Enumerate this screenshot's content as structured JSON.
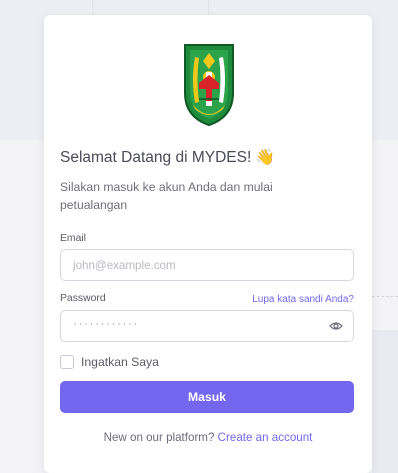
{
  "header": {
    "welcome_title": "Selamat Datang di MYDES! 👋",
    "subtitle": "Silakan masuk ke akun Anda dan mulai petualangan"
  },
  "icons": {
    "logo": "regional-emblem-logo",
    "wave": "waving-hand-icon",
    "password_toggle": "eye-icon"
  },
  "form": {
    "email": {
      "label": "Email",
      "placeholder": "john@example.com",
      "value": ""
    },
    "password": {
      "label": "Password",
      "masked_value": "············",
      "forgot_link": "Lupa kata sandi Anda?"
    },
    "remember": {
      "label": "Ingatkan Saya",
      "checked": false
    },
    "submit_label": "Masuk"
  },
  "footer": {
    "prompt": "New on our platform?",
    "link": "Create an account"
  },
  "colors": {
    "primary": "#7367f0",
    "background": "#f3f3f6",
    "card": "#ffffff",
    "emblem_green": "#1e8a3c",
    "emblem_yellow": "#f2c81b",
    "emblem_red": "#d8232a"
  }
}
